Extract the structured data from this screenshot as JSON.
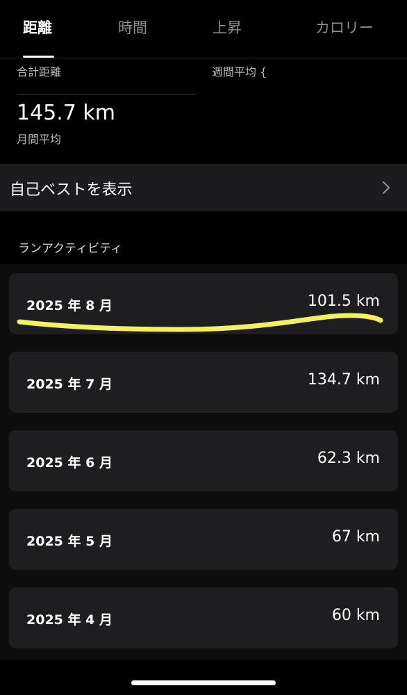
{
  "tabs": [
    {
      "label": "距離",
      "active": true
    },
    {
      "label": "時間",
      "active": false
    },
    {
      "label": "上昇",
      "active": false
    },
    {
      "label": "カロリー",
      "active": false
    }
  ],
  "summary": {
    "total_label": "合計距離",
    "weekly_label": "週間平均 {",
    "monthly_value": "145.7 km",
    "monthly_label": "月間平均"
  },
  "personal_best": {
    "label": "自己ベストを表示",
    "icon": "chevron-right-icon"
  },
  "activity": {
    "section_title": "ランアクティビティ",
    "months": [
      {
        "month": "2025 年 8 月",
        "distance": "101.5 km",
        "highlighted": true
      },
      {
        "month": "2025 年 7 月",
        "distance": "134.7 km"
      },
      {
        "month": "2025 年 6 月",
        "distance": "62.3 km"
      },
      {
        "month": "2025 年 5 月",
        "distance": "67 km"
      },
      {
        "month": "2025 年 4 月",
        "distance": "60 km"
      }
    ]
  },
  "colors": {
    "background": "#000000",
    "card": "#1e1e20",
    "highlight": "#f5f061"
  }
}
